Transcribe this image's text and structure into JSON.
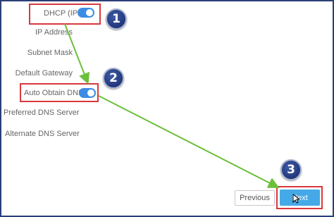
{
  "form": {
    "dhcp": {
      "label": "DHCP (IPv4)",
      "enabled": true
    },
    "ip_address": {
      "label": "IP Address"
    },
    "subnet_mask": {
      "label": "Subnet Mask"
    },
    "default_gateway": {
      "label": "Default Gateway"
    },
    "auto_dns": {
      "label": "Auto Obtain DNS",
      "enabled": true
    },
    "preferred_dns": {
      "label": "Preferred DNS Server"
    },
    "alternate_dns": {
      "label": "Alternate DNS Server"
    }
  },
  "buttons": {
    "previous": "Previous",
    "next": "Next"
  },
  "annotations": {
    "step1": "1",
    "step2": "2",
    "step3": "3"
  },
  "colors": {
    "toggle_on": "#3c8ce6",
    "highlight_box": "#d9383d",
    "arrow": "#6cbf3a",
    "badge": "#22377a",
    "next_button": "#45a9e8",
    "frame_border": "#2b3e78"
  }
}
